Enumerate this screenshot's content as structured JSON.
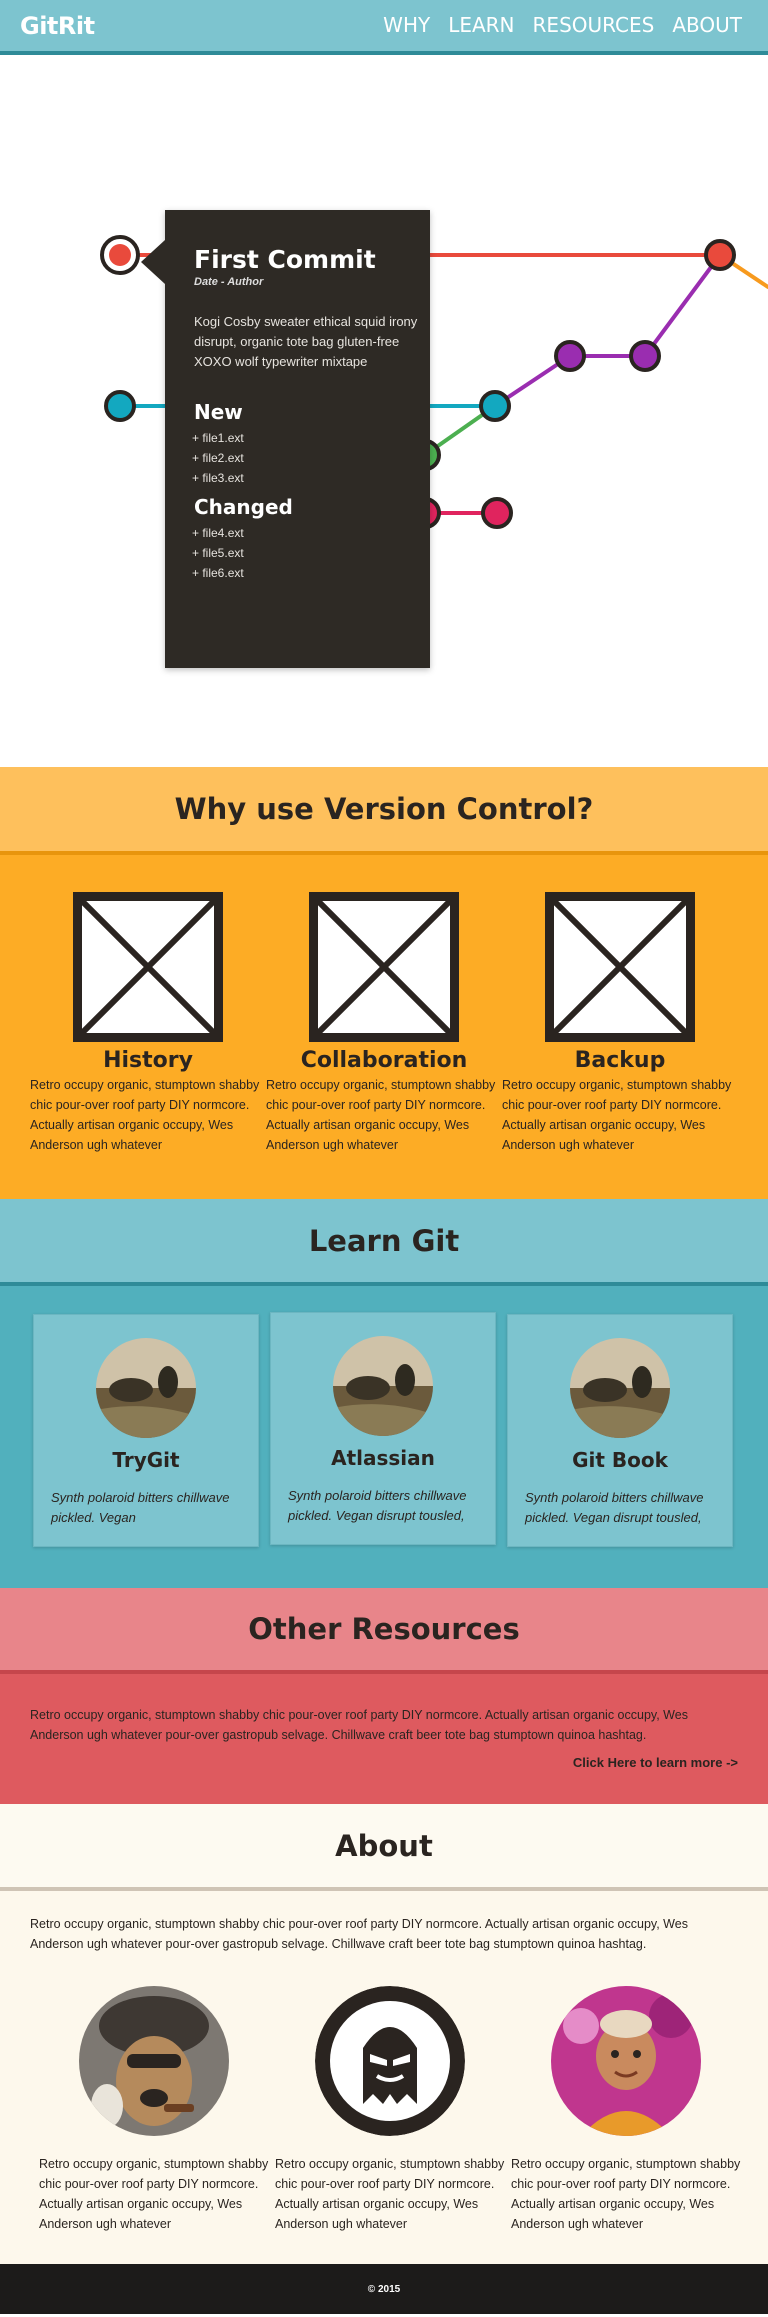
{
  "nav": {
    "logo": "GitRit",
    "links": [
      "WHY",
      "LEARN",
      "RESOURCES",
      "ABOUT"
    ]
  },
  "commit": {
    "title": "First Commit",
    "meta": "Date - Author",
    "description": "Kogi Cosby sweater ethical squid irony disrupt, organic tote bag gluten-free XOXO wolf typewriter mixtape",
    "new_heading": "New",
    "new_files": [
      "+ file1.ext",
      "+ file2.ext",
      "+ file3.ext"
    ],
    "changed_heading": "Changed",
    "changed_files": [
      "+ file4.ext",
      "+ file5.ext",
      "+ file6.ext"
    ]
  },
  "graph_colors": {
    "red": "#e94a3c",
    "orange": "#f79a1e",
    "purple": "#9a2db0",
    "cyan": "#13a8c0",
    "green": "#4caf50",
    "pink": "#e0245e"
  },
  "why": {
    "heading": "Why use Version Control?",
    "features": [
      {
        "title": "History",
        "text": "Retro occupy organic, stumptown shabby chic pour-over roof party DIY normcore. Actually artisan organic occupy, Wes Anderson ugh whatever"
      },
      {
        "title": "Collaboration",
        "text": "Retro occupy organic, stumptown shabby chic pour-over roof party DIY normcore. Actually artisan organic occupy, Wes Anderson ugh whatever"
      },
      {
        "title": "Backup",
        "text": "Retro occupy organic, stumptown shabby chic pour-over roof party DIY normcore. Actually artisan organic occupy, Wes Anderson ugh whatever"
      }
    ]
  },
  "learn": {
    "heading": "Learn Git",
    "cards": [
      {
        "title": "TryGit",
        "text": "Synth polaroid bitters chillwave pickled. Vegan"
      },
      {
        "title": "Atlassian",
        "text": "Synth polaroid bitters chillwave pickled. Vegan disrupt tousled,"
      },
      {
        "title": "Git Book",
        "text": "Synth polaroid bitters chillwave pickled. Vegan disrupt tousled,"
      }
    ]
  },
  "other": {
    "heading": "Other Resources",
    "text": "Retro occupy organic, stumptown shabby chic pour-over roof party DIY normcore. Actually artisan organic occupy, Wes Anderson ugh whatever pour-over gastropub selvage. Chillwave craft beer tote bag stumptown quinoa hashtag.",
    "link": "Click Here to learn more ->"
  },
  "about": {
    "heading": "About",
    "text": "Retro occupy organic, stumptown shabby chic pour-over roof party DIY normcore. Actually artisan organic occupy, Wes Anderson ugh whatever pour-over gastropub selvage. Chillwave craft beer tote bag stumptown quinoa hashtag.",
    "people": [
      {
        "photo": "dog-hat-photo",
        "text": "Retro occupy organic, stumptown shabby chic pour-over roof party DIY normcore. Actually artisan organic occupy, Wes Anderson ugh whatever"
      },
      {
        "photo": "mascot-logo",
        "text": "Retro occupy organic, stumptown shabby chic pour-over roof party DIY normcore. Actually artisan organic occupy, Wes Anderson ugh whatever"
      },
      {
        "photo": "child-photo",
        "text": "Retro occupy organic, stumptown shabby chic pour-over roof party DIY normcore. Actually artisan organic occupy, Wes Anderson ugh whatever"
      }
    ]
  },
  "footer": {
    "copyright": "© 2015"
  }
}
